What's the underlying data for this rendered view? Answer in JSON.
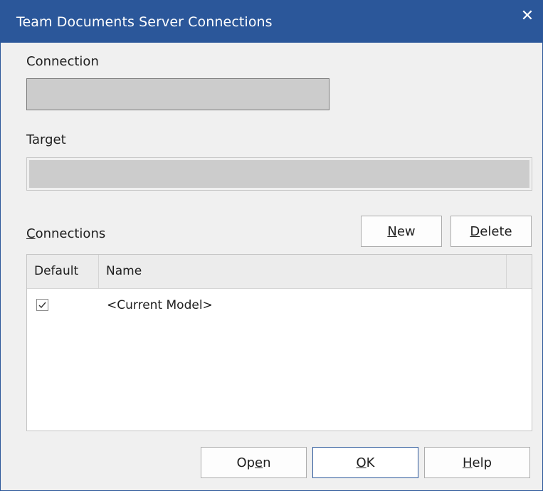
{
  "window": {
    "title": "Team Documents Server Connections",
    "close_glyph": "✕"
  },
  "connection": {
    "label": "Connection",
    "value": ""
  },
  "target": {
    "label": "Target",
    "value": ""
  },
  "connections": {
    "label_first": "C",
    "label_rest": "onnections",
    "new_button": {
      "accel": "N",
      "rest": "ew"
    },
    "delete_button": {
      "accel": "D",
      "rest": "elete"
    },
    "columns": [
      "Default",
      "Name"
    ],
    "rows": [
      {
        "default": true,
        "name": "<Current Model>"
      }
    ]
  },
  "footer": {
    "open_button": {
      "pre": "Op",
      "accel": "e",
      "post": "n"
    },
    "ok_button": {
      "accel": "O",
      "post": "K"
    },
    "help_button": {
      "accel": "H",
      "post": "elp"
    }
  },
  "icons": {
    "close": "close-icon",
    "check": "checkmark-icon"
  },
  "colors": {
    "titlebar": "#2b579a",
    "dialog_bg": "#f0f0f0",
    "field_bg": "#cccccc"
  }
}
